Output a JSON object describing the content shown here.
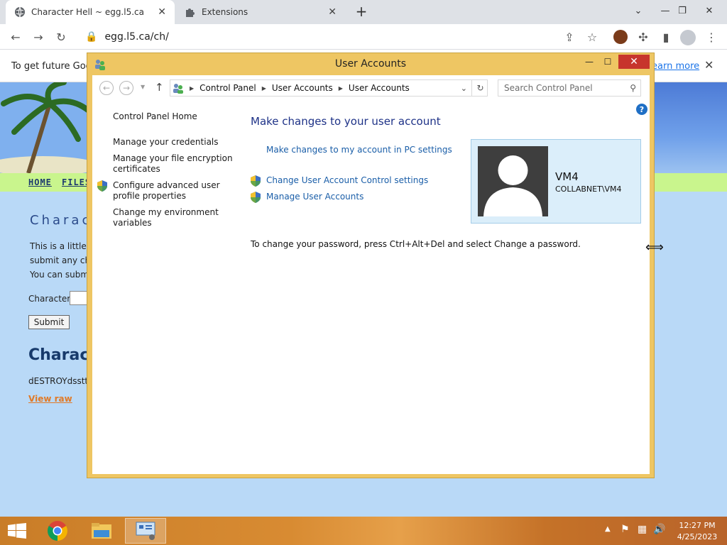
{
  "browser": {
    "tabs": [
      {
        "title": "Character Hell ~ egg.l5.ca",
        "active": true,
        "favicon": "globe-icon"
      },
      {
        "title": "Extensions",
        "active": false,
        "favicon": "puzzle-icon"
      }
    ],
    "new_tab_glyph": "+",
    "url": "egg.l5.ca/ch/",
    "infobar": {
      "message": "To get future Goog",
      "learn_more": "earn more"
    }
  },
  "webpage": {
    "nav": [
      "HOME",
      "FILES"
    ],
    "heading": "Charac",
    "lines": [
      "This is a little",
      "submit any cha",
      "You can submi"
    ],
    "character_label": "Character",
    "submit_label": "Submit",
    "subheading": "Charac",
    "dump": "dESTROYdsstttt",
    "view_raw": "View raw"
  },
  "window": {
    "title": "User Accounts",
    "breadcrumb": [
      "Control Panel",
      "User Accounts",
      "User Accounts"
    ],
    "search_placeholder": "Search Control Panel",
    "help_glyph": "?",
    "sidebar": {
      "home": "Control Panel Home",
      "credentials": "Manage your credentials",
      "encryption": "Manage your file encryption certificates",
      "advanced_profile": "Configure advanced user profile properties",
      "environment": "Change my environment variables"
    },
    "heading": "Make changes to your user account",
    "pc_settings_link": "Make changes to my account in PC settings",
    "uac_link": "Change User Account Control settings",
    "manage_link": "Manage User Accounts",
    "password_hint": "To change your password, press Ctrl+Alt+Del and select Change a password.",
    "user": {
      "name": "VM4",
      "domain": "COLLABNET\\VM4"
    }
  },
  "taskbar": {
    "time": "12:27 PM",
    "date": "4/25/2023"
  },
  "colors": {
    "window_frame": "#eec663",
    "close_button": "#c7352c",
    "link_blue": "#1a5ea8",
    "heading_blue": "#1e3287",
    "nav_green": "#c9f58d"
  }
}
